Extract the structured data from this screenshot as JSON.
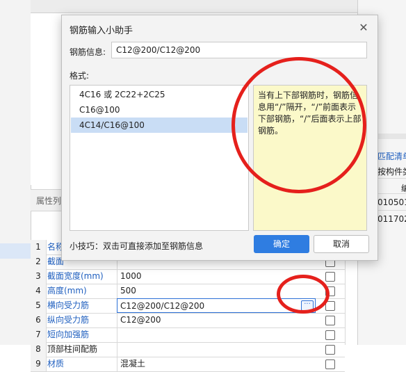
{
  "dialog": {
    "title": "钢筋输入小助手",
    "close_glyph": "✕",
    "info_label": "钢筋信息:",
    "info_value": "C12@200/C12@200",
    "format_label": "格式:",
    "format_items": [
      {
        "label": "4C16 或 2C22+2C25",
        "selected": false
      },
      {
        "label": "C16@100",
        "selected": false
      },
      {
        "label": "4C14/C16@100",
        "selected": true
      }
    ],
    "hint": "当有上下部钢筋时，钢筋信息用“/”隔开，“/”前面表示下部钢筋，“/”后面表示上部钢筋。",
    "tip": "小技巧：双击可直接添加至钢筋信息",
    "ok_label": "确定",
    "cancel_label": "取消"
  },
  "panel": {
    "title": "属性列",
    "rows": [
      {
        "num": "1",
        "name": "名称",
        "value": ""
      },
      {
        "num": "2",
        "name": "截面",
        "value": ""
      },
      {
        "num": "3",
        "name": "截面宽度(mm)",
        "value": "1000"
      },
      {
        "num": "4",
        "name": "高度(mm)",
        "value": "500"
      },
      {
        "num": "5",
        "name": "横向受力筋",
        "value": "C12@200/C12@200",
        "active": true
      },
      {
        "num": "6",
        "name": "纵向受力筋",
        "value": "C12@200"
      },
      {
        "num": "7",
        "name": "短向加强筋",
        "value": ""
      },
      {
        "num": "8",
        "name": "顶部柱间配筋",
        "value": ""
      },
      {
        "num": "9",
        "name": "材质",
        "value": "混凝土"
      }
    ],
    "ellipsis_glyph": "···"
  },
  "right_panel": {
    "link": "匹配清单",
    "header": "按构件类",
    "col": "编",
    "cells": [
      "010501",
      "011702"
    ]
  },
  "colors": {
    "accent": "#2f7de1",
    "annotation": "#e5201c",
    "hint_bg": "#fbf9c9",
    "selection": "#c9ddf5"
  }
}
